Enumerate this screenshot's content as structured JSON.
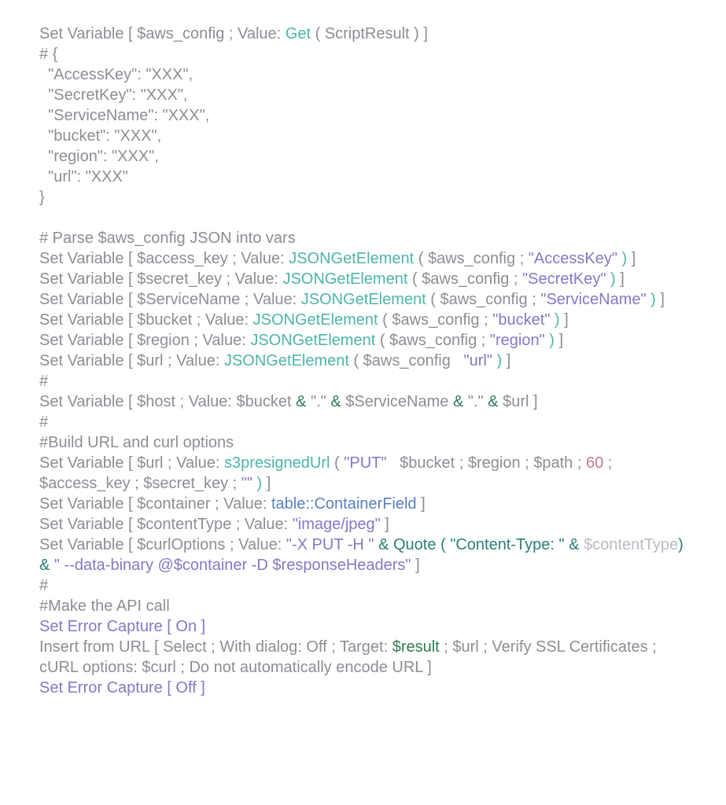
{
  "code": {
    "l01": {
      "a": "Set Variable [ $aws_config ; Value: ",
      "b": "Get",
      "c": " ( ScriptResult ) ]"
    },
    "l02": "# {",
    "l03": "  \"AccessKey\": \"XXX\",",
    "l04": "  \"SecretKey\": \"XXX\",",
    "l05": "  \"ServiceName\": \"XXX\",",
    "l06": "  \"bucket\": \"XXX\",",
    "l07": "  \"region\": \"XXX\",",
    "l08": "  \"url\": \"XXX\"",
    "l09": "}",
    "blank1": "",
    "l10": "# Parse $aws_config JSON into vars",
    "l11p1": "Set Variable [ $access_key ; Value: ",
    "l11p2": "JSONGetElement",
    "l11p3": " ( $aws_config ; ",
    "l11p4": "\"AccessKey\"",
    "l11p5": " ) ",
    "l11p6": "]",
    "l12p1": "Set Variable [ $secret_key ; Value: ",
    "l12p2": "JSONGetElement",
    "l12p3": " ( $aws_config ; ",
    "l12p4": "\"SecretKey\"",
    "l12p5": " ) ",
    "l12p6": "]",
    "l13p1": "Set Variable [ $ServiceName ; Value: ",
    "l13p2": "JSONGetElement",
    "l13p3": " ( $aws_config ; ",
    "l13p4": "\"ServiceName\"",
    "l13p5": " ) ",
    "l13p6": "]",
    "l14p1": "Set Variable [ $bucket ; Value: ",
    "l14p2": "JSONGetElement",
    "l14p3": " ( $aws_config ; ",
    "l14p4": "\"bucket\"",
    "l14p5": " ) ",
    "l14p6": "]",
    "l15p1": "Set Variable [ $region ; Value: ",
    "l15p2": "JSONGetElement",
    "l15p3": " ( $aws_config ; ",
    "l15p4": "\"region\"",
    "l15p5": " ) ",
    "l15p6": "]",
    "l16p1": "Set Variable [ $url ; Value: ",
    "l16p2": "JSONGetElement",
    "l16p3": " ( $aws_config   ",
    "l16p4": "\"url\"",
    "l16p5": " ) ",
    "l16p6": "]",
    "l17": "#",
    "l18p1": "Set Variable [ $host ; Value: $bucket ",
    "l18p2": "&",
    "l18p3": " \".\" ",
    "l18p4": "&",
    "l18p5": " $ServiceName ",
    "l18p6": "&",
    "l18p7": " \".\" ",
    "l18p8": "&",
    "l18p9": " $url ]",
    "l19": "#",
    "l20": "#Build URL and curl options",
    "l21p1": "Set Variable [ $url ; Value: ",
    "l21p2": "s3presignedUrl",
    "l21p3": " ( ",
    "l21p4": "\"PUT\"",
    "l21p5": "   $bucket ; $region ; $path ; ",
    "l21p6": "60",
    "l21p7": " ; $access_key ; $secret_key ; ",
    "l21p8": "\"\"",
    "l21p9": " ) ",
    "l21p10": "]",
    "l22p1": "Set Variable [ $container ; Value: ",
    "l22p2": "table::ContainerField",
    "l22p3": " ]",
    "l23p1": "Set Variable [ $contentType ; Value: ",
    "l23p2": "\"image/jpeg\"",
    "l23p3": " ]",
    "l24p1": "Set Variable [ $curlOptions ; Value: ",
    "l24p2": "\"-X PUT -H \"",
    "l24p3": " & ",
    "l24p4": "Quote",
    "l24p5": " ( ",
    "l24p6": "\"Content-Type: \"",
    "l24p7": " & ",
    "l24p8": "$contentType",
    "l24p9": ")",
    "l24p10": " & ",
    "l24p11": "\" --data-binary @$container -D $responseHeaders\"",
    "l24p12": " ]",
    "l25": "#",
    "l26": "#Make the API call",
    "l27p1": "Set Error Capture ",
    "l27p2": "[ On ]",
    "l28p1": "Insert from URL [ Select ; With dialog: Off ; Target: ",
    "l28p2": "$result",
    "l28p3": " ; $url ; Verify SSL Certificates ; cURL options: $curl ; Do not automatically encode URL ]",
    "l29p1": "Set Error Capture ",
    "l29p2": "[ Off ]"
  }
}
